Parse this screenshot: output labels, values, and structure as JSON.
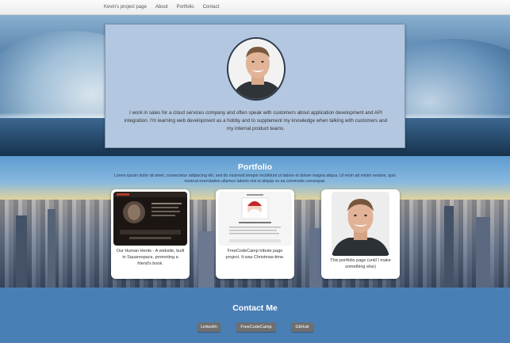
{
  "nav": {
    "brand": "Kevin's project page",
    "items": [
      "About",
      "Portfolio",
      "Contact"
    ]
  },
  "about": {
    "text": "I work in sales for a cloud services company and often speak with customers about application development and API integration. I'm learning web development as a hobby and to supplement my knowledge when talking with customers and my internal product teams."
  },
  "portfolio": {
    "title": "Portfolio",
    "intro": "Lorem ipsum dolor sit amet, consectetur adipiscing elit, sed do eiusmod tempor incididunt ut labore et dolore magna aliqua. Ut enim ad minim veniam, quis nostrud exercitation ullamco laboris nisi ut aliquip ex ea commodo consequat.",
    "cards": [
      {
        "caption": "Our Human Hents - A website, built in Squarespace, promoting a friend's book."
      },
      {
        "caption": "FreeCodeCamp tribute page project. It was Christmas-time."
      },
      {
        "caption": "This portfolio page (until I make something else)"
      }
    ]
  },
  "contact": {
    "title": "Contact Me",
    "buttons": [
      "LinkedIn",
      "FreeCodeCamp",
      "GitHub"
    ]
  },
  "colors": {
    "contact_bg": "#4a7fb5",
    "about_card_bg": "#b4c7e0",
    "button_bg": "#6f6f6f"
  }
}
